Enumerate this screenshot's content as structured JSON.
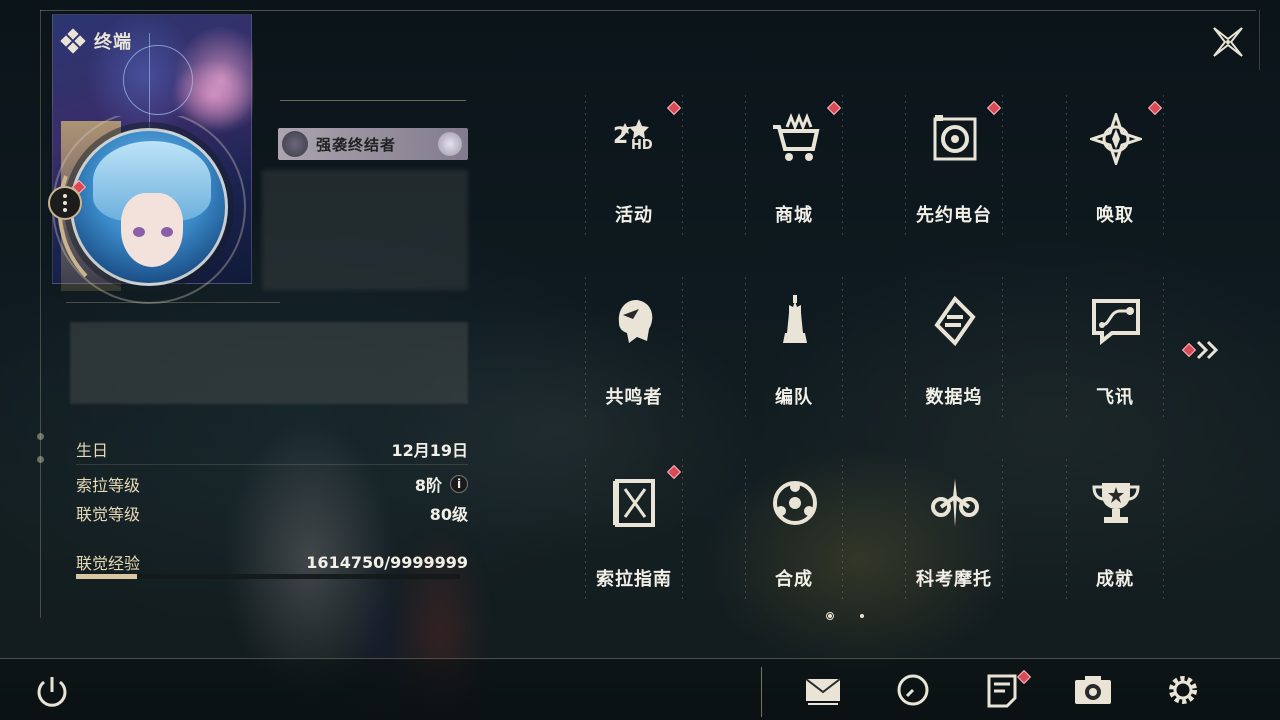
{
  "header": {
    "title": "终端"
  },
  "profile": {
    "title_tag": "强袭终结者"
  },
  "stats": {
    "birthday": {
      "label": "生日",
      "value": "12月19日"
    },
    "sola_level": {
      "label": "索拉等级",
      "value": "8阶",
      "info": "i"
    },
    "union_level": {
      "label": "联觉等级",
      "value": "80级"
    },
    "union_exp": {
      "label": "联觉经验",
      "value": "1614750/9999999",
      "progress": 0.16
    }
  },
  "menu": {
    "items": [
      {
        "label": "活动",
        "icon": "events-2nd-icon",
        "badge": true
      },
      {
        "label": "商城",
        "icon": "shop-cart-icon",
        "badge": true
      },
      {
        "label": "先约电台",
        "icon": "radio-icon",
        "badge": true
      },
      {
        "label": "唤取",
        "icon": "convene-star-icon",
        "badge": true
      },
      {
        "label": "共鸣者",
        "icon": "resonator-head-icon",
        "badge": false
      },
      {
        "label": "编队",
        "icon": "team-chess-icon",
        "badge": false
      },
      {
        "label": "数据坞",
        "icon": "data-bank-icon",
        "badge": false
      },
      {
        "label": "飞讯",
        "icon": "message-chat-icon",
        "badge": false
      },
      {
        "label": "索拉指南",
        "icon": "guide-book-icon",
        "badge": true
      },
      {
        "label": "合成",
        "icon": "synthesis-icon",
        "badge": false
      },
      {
        "label": "科考摩托",
        "icon": "motorcycle-icon",
        "badge": false
      },
      {
        "label": "成就",
        "icon": "trophy-icon",
        "badge": false
      }
    ],
    "page_current": 1,
    "page_total": 2
  },
  "colors": {
    "accent_gold": "#c9b48c",
    "badge_red": "#d94a56",
    "text_primary": "#f2efe6"
  }
}
